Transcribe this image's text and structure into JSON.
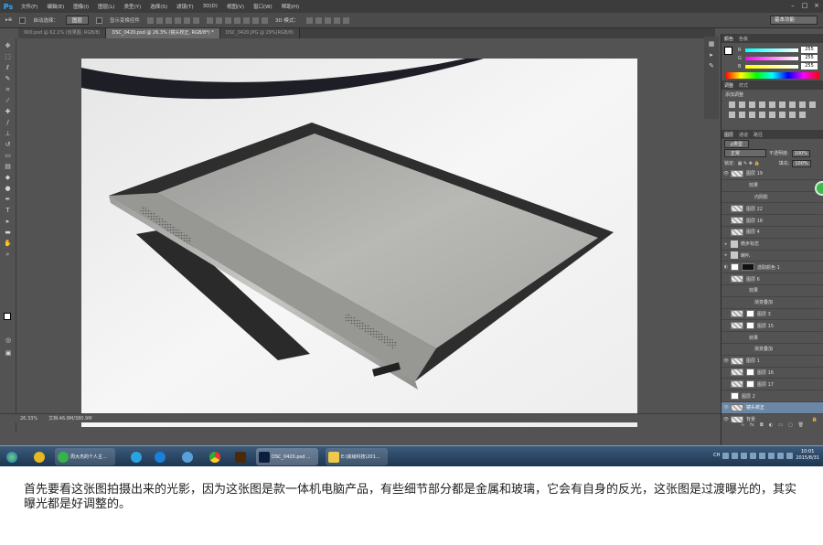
{
  "app": {
    "logo": "Ps"
  },
  "menubar": {
    "items": [
      "文件(F)",
      "编辑(E)",
      "图像(I)",
      "图层(L)",
      "类型(Y)",
      "选择(S)",
      "滤镜(T)",
      "3D(D)",
      "视图(V)",
      "窗口(W)",
      "帮助(H)"
    ]
  },
  "options": {
    "auto_select": "自动选择：",
    "auto_select_value": "图层",
    "show_transform": "显示变换控件",
    "mode_3d": "3D 模式：",
    "workspace": "基本功能"
  },
  "tabs": [
    {
      "label": "900.psd @ 62.1% (效果图, RGB/8)"
    },
    {
      "label": "DSC_0420.psd @ 26.3% (镜头校正, RGB/8*) *"
    },
    {
      "label": "DSC_0420.JPG @ 29%(RGB/8)"
    }
  ],
  "status": {
    "zoom": "26.33%",
    "doc": "文档:46.8M/380.9M"
  },
  "color_panel": {
    "tabs": [
      "颜色",
      "色板"
    ],
    "r": "255",
    "g": "255",
    "b": "255",
    "labels": [
      "R",
      "G",
      "B"
    ]
  },
  "adjust_panel": {
    "tabs": [
      "调整",
      "样式"
    ],
    "title": "添加调整"
  },
  "layers_panel": {
    "tabs": [
      "图层",
      "通道",
      "路径"
    ],
    "filter": "ρ类型",
    "blend": "正常",
    "opacity_label": "不透明度:",
    "opacity": "100%",
    "lock_label": "锁定:",
    "fill_label": "填充:",
    "fill": "100%",
    "layers": [
      {
        "name": "图层 19"
      },
      {
        "name": "效果"
      },
      {
        "name": "内阴影"
      },
      {
        "name": "图层 22"
      },
      {
        "name": "图层 18"
      },
      {
        "name": "图层 4"
      },
      {
        "name": "微步标志"
      },
      {
        "name": "喇叭"
      },
      {
        "name": "选取颜色 1"
      },
      {
        "name": "图层 6"
      },
      {
        "name": "效果"
      },
      {
        "name": "渐变叠加"
      },
      {
        "name": "图层 3"
      },
      {
        "name": "图层 15"
      },
      {
        "name": "效果"
      },
      {
        "name": "渐变叠加"
      },
      {
        "name": "图层 1"
      },
      {
        "name": "图层 16"
      },
      {
        "name": "图层 17"
      },
      {
        "name": "图层 2"
      },
      {
        "name": "镜头校正"
      },
      {
        "name": "背景"
      }
    ]
  },
  "taskbar": {
    "items": [
      "周大杰的个人主...",
      "DSC_0420.psd ...",
      "E:\\高级科技\\201..."
    ],
    "lang": "CH",
    "time": "10:01",
    "date": "2015/8/31"
  },
  "caption": "首先要看这张图拍摄出来的光影，因为这张图是款一体机电脑产品，有些细节部分都是金属和玻璃，它会有自身的反光，这张图是过渡曝光的，其实曝光都是好调整的。"
}
